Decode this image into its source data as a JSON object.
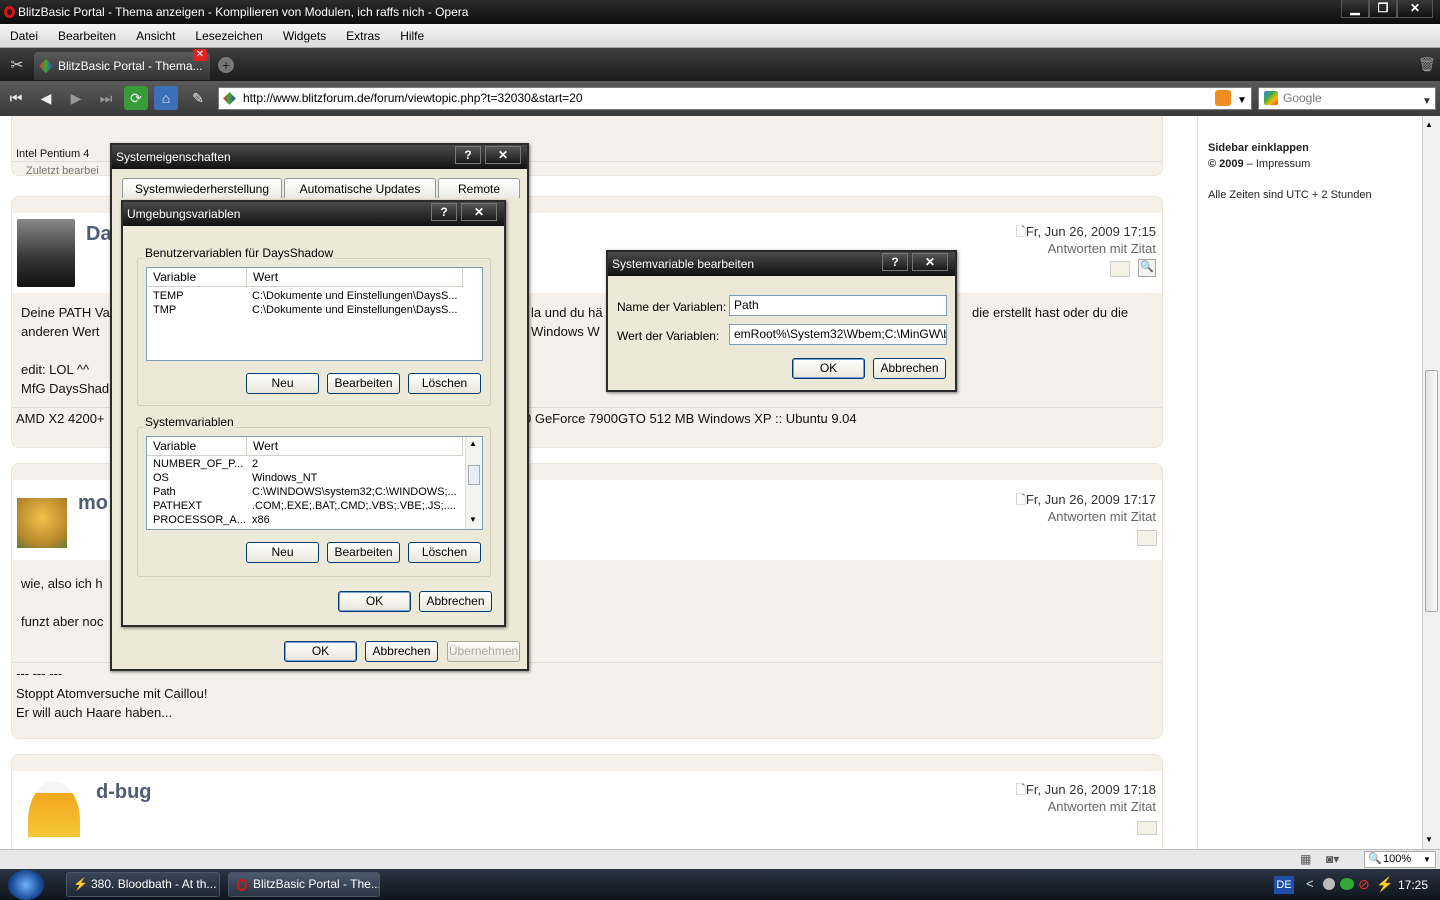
{
  "window": {
    "title": "BlitzBasic Portal - Thema anzeigen - Kompilieren von Modulen, ich raffs nich - Opera",
    "min": "▁",
    "max": "❐",
    "close": "✕"
  },
  "menu": [
    "Datei",
    "Bearbeiten",
    "Ansicht",
    "Lesezeichen",
    "Widgets",
    "Extras",
    "Hilfe"
  ],
  "tab": {
    "label": "BlitzBasic Portal - Thema..."
  },
  "address": {
    "url": "http://www.blitzforum.de/forum/viewtopic.php?t=32030&start=20",
    "search_placeholder": "Google"
  },
  "page": {
    "top_post": {
      "sig": "Intel Pentium 4",
      "edited": "Zuletzt bearbei"
    },
    "post1": {
      "author": "Da",
      "date": "Fr, Jun 26, 2009 17:15",
      "quote": "Antworten mit Zitat",
      "l1": "Deine PATH Va",
      "l1b": "la und du hä",
      "l1c": "die erstellt hast oder du die",
      "l2": "anderen Wert",
      "l2b": "Windows W",
      "l3": "edit: LOL ^^",
      "l4": "MfG DaysShad",
      "sig_a": "AMD X2 4200+",
      "sig_b": "0 GeForce 7900GTO 512 MB Windows XP :: Ubuntu 9.04"
    },
    "post2": {
      "author": "mo",
      "date": "Fr, Jun 26, 2009 17:17",
      "quote": "Antworten mit Zitat",
      "l1": "wie, also ich h",
      "l2": "funzt aber noc",
      "sig1": "--- --- ---",
      "sig2": "Stoppt Atomversuche mit Caillou!",
      "sig3": "Er will auch Haare haben..."
    },
    "post3": {
      "author": "d-bug",
      "date": "Fr, Jun 26, 2009 17:18",
      "quote": "Antworten mit Zitat"
    },
    "sidebar": {
      "collapse": "Sidebar einklappen",
      "copyright": "© 2009",
      "impressum": "Impressum",
      "timezone": "Alle Zeiten sind UTC + 2 Stunden"
    }
  },
  "dlg_sys": {
    "title": "Systemeigenschaften",
    "tabs": [
      "Systemwiederherstellung",
      "Automatische Updates",
      "Remote"
    ],
    "ok": "OK",
    "cancel": "Abbrechen",
    "apply": "Übernehmen"
  },
  "dlg_env": {
    "title": "Umgebungsvariablen",
    "user_group": "Benutzervariablen für DaysShadow",
    "sys_group": "Systemvariablen",
    "col_var": "Variable",
    "col_val": "Wert",
    "user_vars": [
      {
        "name": "TEMP",
        "value": "C:\\Dokumente und Einstellungen\\DaysS..."
      },
      {
        "name": "TMP",
        "value": "C:\\Dokumente und Einstellungen\\DaysS..."
      }
    ],
    "sys_vars": [
      {
        "name": "NUMBER_OF_P...",
        "value": "2"
      },
      {
        "name": "OS",
        "value": "Windows_NT"
      },
      {
        "name": "Path",
        "value": "C:\\WINDOWS\\system32;C:\\WINDOWS;..."
      },
      {
        "name": "PATHEXT",
        "value": ".COM;.EXE;.BAT;.CMD;.VBS;.VBE;.JS;...."
      },
      {
        "name": "PROCESSOR_A...",
        "value": "x86"
      }
    ],
    "new": "Neu",
    "edit": "Bearbeiten",
    "delete": "Löschen",
    "ok": "OK",
    "cancel": "Abbrechen"
  },
  "dlg_edit": {
    "title": "Systemvariable bearbeiten",
    "name_label": "Name der Variablen:",
    "value_label": "Wert der Variablen:",
    "name_value": "Path",
    "value_value": "emRoot%\\System32\\Wbem;C:\\MinGW\\bin",
    "ok": "OK",
    "cancel": "Abbrechen"
  },
  "statusbar": {
    "zoom": "100%"
  },
  "taskbar": {
    "items": [
      "380. Bloodbath - At th...",
      "BlitzBasic Portal - The..."
    ],
    "lang": "DE",
    "time": "17:25"
  },
  "colors": {
    "accent": "#4e5c75",
    "post_bg": "#f5f1ea",
    "dialog_bg": "#ece9d8"
  }
}
